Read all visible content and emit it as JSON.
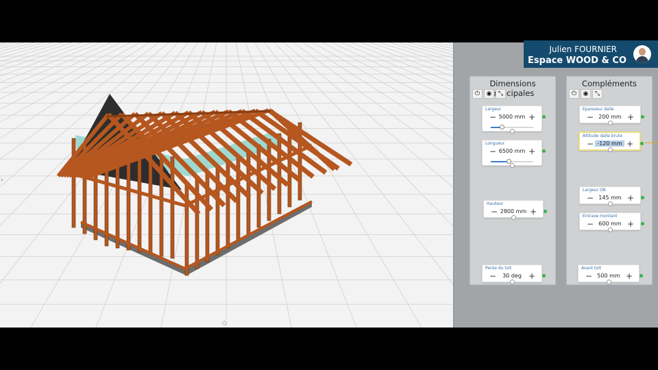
{
  "user": {
    "name": "Julien FOURNIER",
    "company": "Espace WOOD & CO",
    "chevron_icon": "chevron-down-icon",
    "avatar_icon": "user-avatar"
  },
  "panels": {
    "dimensions": {
      "title": "Dimensions principales",
      "tools": [
        {
          "icon": "power-icon",
          "glyph": "⏻"
        },
        {
          "icon": "eye-icon",
          "glyph": "◉"
        },
        {
          "icon": "collapse-icon",
          "glyph": "⤡"
        }
      ],
      "fields": [
        {
          "label": "Largeur",
          "value": "5000 mm",
          "minus": "−",
          "plus": "+",
          "slider": 0.25
        },
        {
          "label": "Longueur",
          "value": "6500 mm",
          "minus": "−",
          "plus": "+",
          "slider": 0.42
        },
        {
          "label": "Hauteur",
          "value": "2800 mm",
          "minus": "−",
          "plus": "+"
        },
        {
          "label": "Pente du toit",
          "value": "30 deg",
          "minus": "−",
          "plus": "+"
        }
      ]
    },
    "complements": {
      "title": "Compléments",
      "tools": [
        {
          "icon": "power-icon",
          "glyph": "⏻"
        },
        {
          "icon": "eye-icon",
          "glyph": "◉"
        },
        {
          "icon": "collapse-icon",
          "glyph": "⤡"
        }
      ],
      "fields": [
        {
          "label": "Epaisseur dalle",
          "value": "200 mm",
          "minus": "−",
          "plus": "+"
        },
        {
          "label": "Altitude dalle brute",
          "value": "-120 mm",
          "minus": "−",
          "plus": "+",
          "selected": true
        },
        {
          "label": "Largeur OB",
          "value": "145 mm",
          "minus": "−",
          "plus": "+"
        },
        {
          "label": "Entraxe montant",
          "value": "600 mm",
          "minus": "−",
          "plus": "+"
        },
        {
          "label": "Avant toit",
          "value": "500 mm",
          "minus": "−",
          "plus": "+"
        }
      ]
    }
  },
  "viewport": {
    "left_arrow": "›",
    "bottom_arrow": "◇"
  },
  "colors": {
    "header_bg": "#144a6d",
    "panel_bg": "#cfd1d3",
    "sidebar_bg": "#a2a5a8",
    "wood": "#b5571f",
    "status": "#36b24a",
    "highlight": "#ece07e"
  }
}
